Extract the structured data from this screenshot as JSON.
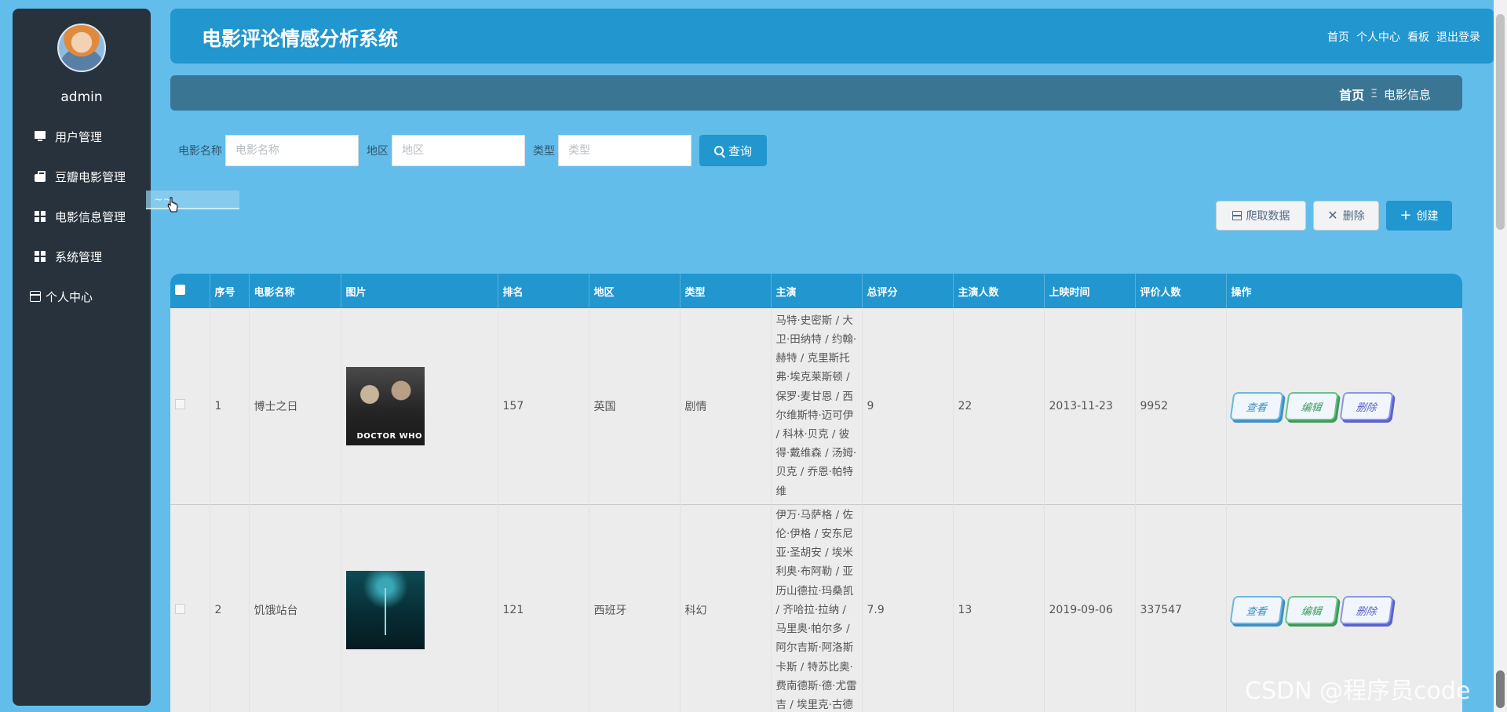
{
  "sidebar": {
    "username": "admin",
    "items": [
      {
        "label": "用户管理",
        "icon": "monitor-icon"
      },
      {
        "label": "豆瓣电影管理",
        "icon": "bag-icon"
      },
      {
        "label": "电影信息管理",
        "icon": "grid-icon"
      },
      {
        "label": "系统管理",
        "icon": "grid-icon"
      },
      {
        "label": "个人中心",
        "icon": "card-icon"
      }
    ],
    "drag_ghost_label": "~~ "
  },
  "header": {
    "title": "电影评论情感分析系统",
    "links": [
      "首页",
      "个人中心",
      "看板",
      "退出登录"
    ]
  },
  "breadcrumb": {
    "home": "首页",
    "separator": "Ξ",
    "current": "电影信息"
  },
  "search": {
    "fields": [
      {
        "label": "电影名称",
        "placeholder": "电影名称",
        "value": ""
      },
      {
        "label": "地区",
        "placeholder": "地区",
        "value": ""
      },
      {
        "label": "类型",
        "placeholder": "类型",
        "value": ""
      }
    ],
    "query_label": "查询"
  },
  "toolbar": {
    "crawl_label": "爬取数据",
    "delete_label": "删除",
    "create_label": "创建"
  },
  "table": {
    "columns": [
      "序号",
      "电影名称",
      "图片",
      "排名",
      "地区",
      "类型",
      "主演",
      "总评分",
      "主演人数",
      "上映时间",
      "评价人数",
      "操作"
    ],
    "rows": [
      {
        "index": "1",
        "name": "博士之日",
        "rank": "157",
        "region": "英国",
        "genre": "剧情",
        "actors": "马特·史密斯 / 大卫·田纳特 / 约翰·赫特 / 克里斯托弗·埃克莱斯顿 / 保罗·麦甘恩 / 西尔维斯特·迈可伊 / 科林·贝克 / 彼得·戴维森 / 汤姆·贝克 / 乔恩·帕特维",
        "score": "9",
        "actor_count": "22",
        "release": "2013-11-23",
        "reviews": "9952"
      },
      {
        "index": "2",
        "name": "饥饿站台",
        "rank": "121",
        "region": "西班牙",
        "genre": "科幻",
        "actors": "伊万·马萨格 / 佐伦·伊格 / 安东尼亚·圣胡安 / 埃米利奥·布阿勒 / 亚历山德拉·玛桑凯 / 齐哈拉·拉纳 / 马里奥·帕尔多 / 阿尔吉斯·阿洛斯卡斯 / 特苏比奥·费南德斯·德·尤雷吉 / 埃里克·古德",
        "score": "7.9",
        "actor_count": "13",
        "release": "2019-09-06",
        "reviews": "337547"
      }
    ],
    "op_view": "查看",
    "op_edit": "编辑",
    "op_delete": "删除"
  },
  "watermark": "CSDN @程序员code",
  "colors": {
    "page_bg": "#63bdea",
    "sidebar_bg": "#27323c",
    "primary": "#2196cf",
    "breadcrumb_bg": "#3a7594"
  }
}
